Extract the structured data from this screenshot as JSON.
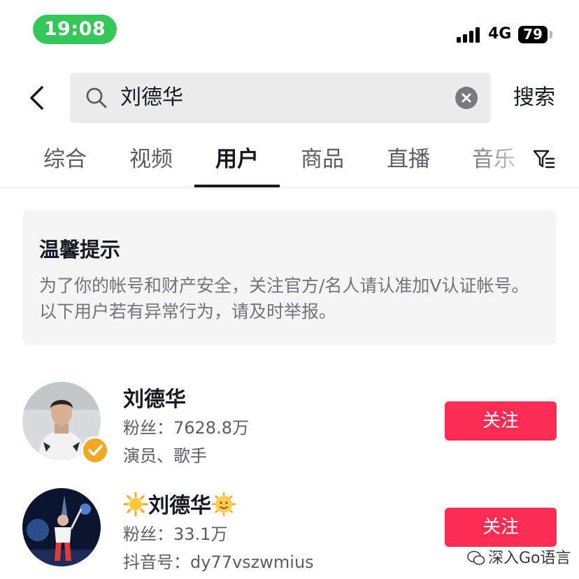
{
  "status_bar": {
    "time": "19:08",
    "network": "4G",
    "battery": "79"
  },
  "search": {
    "query": "刘德华",
    "submit_label": "搜索"
  },
  "tabs": [
    {
      "label": "综合"
    },
    {
      "label": "视频"
    },
    {
      "label": "用户",
      "active": true
    },
    {
      "label": "商品"
    },
    {
      "label": "直播"
    },
    {
      "label": "音乐"
    }
  ],
  "tip": {
    "title": "温馨提示",
    "body": "为了你的帐号和财产安全，关注官方/名人请认准加V认证帐号。以下用户若有异常行为，请及时举报。"
  },
  "users": [
    {
      "name": "刘德华",
      "fans": "粉丝：7628.8万",
      "desc": "演员、歌手",
      "follow_label": "关注",
      "verified": true
    },
    {
      "name": "刘德华",
      "fans": "粉丝：33.1万",
      "desc": "抖音号：dy77vszwmius",
      "follow_label": "关注",
      "verified": false
    }
  ],
  "watermark": "深入Go语言",
  "colors": {
    "accent": "#fe2c55",
    "time_pill": "#34c759",
    "verified": "#f5a623"
  },
  "icons": [
    "back-icon",
    "search-icon",
    "clear-icon",
    "filter-icon",
    "verified-icon",
    "sun-emoji",
    "sun-face-emoji",
    "wechat-icon"
  ]
}
